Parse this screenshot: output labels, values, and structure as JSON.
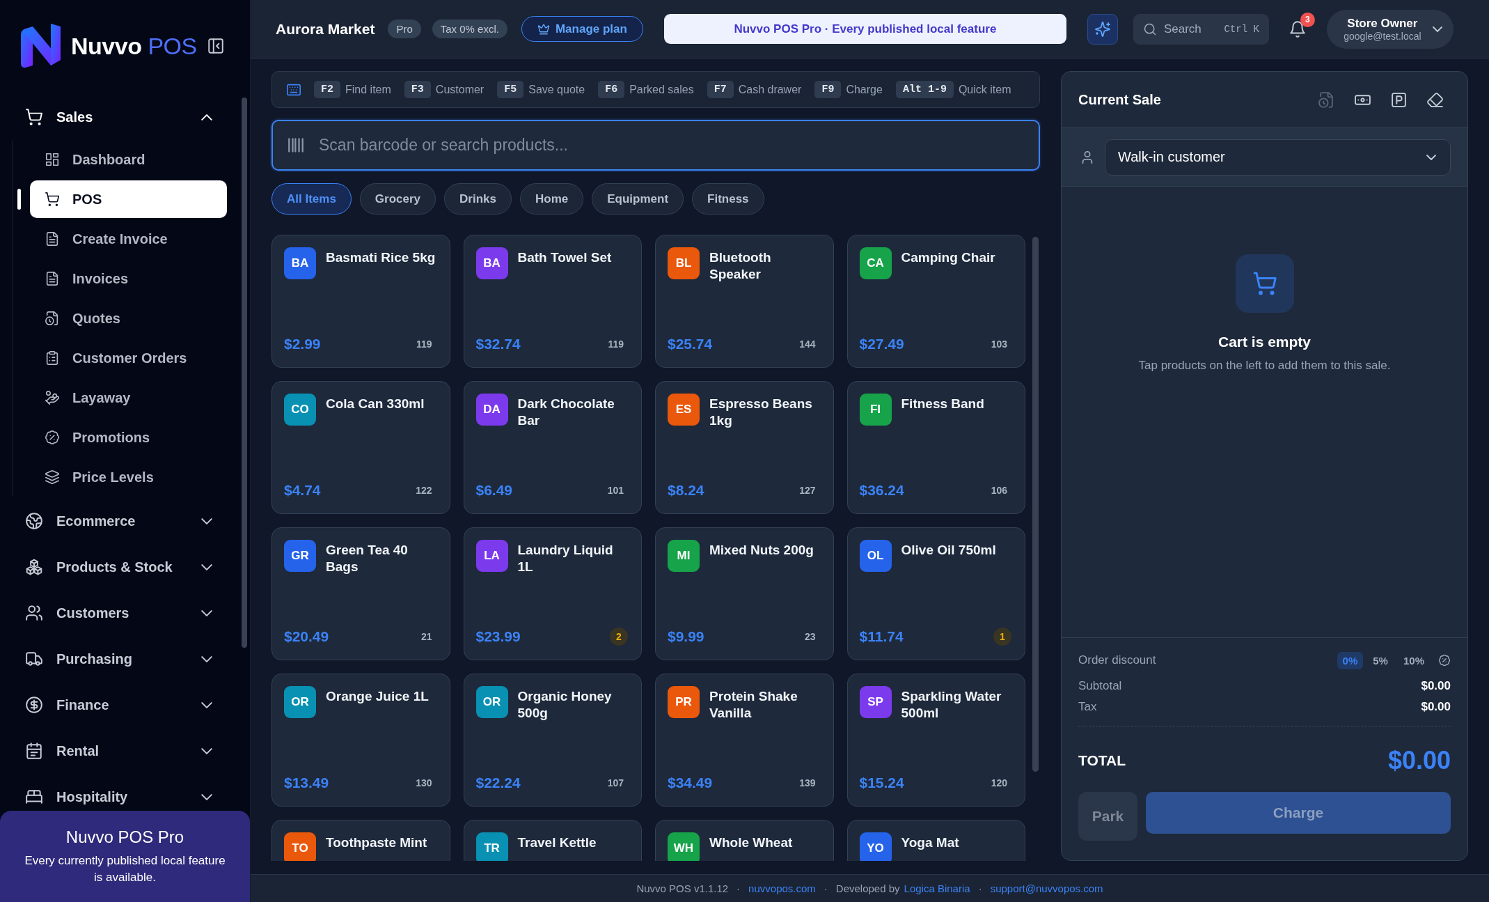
{
  "sidebar": {
    "brand": {
      "name": "Nuvvo",
      "suffix": "POS"
    },
    "nav": [
      {
        "label": "Sales",
        "expanded": true,
        "children": [
          {
            "label": "Dashboard",
            "selected": false
          },
          {
            "label": "POS",
            "selected": true
          },
          {
            "label": "Create Invoice",
            "selected": false
          },
          {
            "label": "Invoices",
            "selected": false
          },
          {
            "label": "Quotes",
            "selected": false
          },
          {
            "label": "Customer Orders",
            "selected": false
          },
          {
            "label": "Layaway",
            "selected": false
          },
          {
            "label": "Promotions",
            "selected": false
          },
          {
            "label": "Price Levels",
            "selected": false
          }
        ]
      },
      {
        "label": "Ecommerce",
        "expanded": false
      },
      {
        "label": "Products & Stock",
        "expanded": false
      },
      {
        "label": "Customers",
        "expanded": false
      },
      {
        "label": "Purchasing",
        "expanded": false
      },
      {
        "label": "Finance",
        "expanded": false
      },
      {
        "label": "Rental",
        "expanded": false
      },
      {
        "label": "Hospitality",
        "expanded": false
      }
    ],
    "promo": {
      "title": "Nuvvo POS Pro",
      "text": "Every currently published local feature is available."
    }
  },
  "topbar": {
    "store": "Aurora Market",
    "plan": "Pro",
    "tax": "Tax 0% excl.",
    "manage_plan": "Manage plan",
    "banner": "Nuvvo POS Pro · Every published local feature",
    "search": {
      "placeholder": "Search",
      "shortcut": "Ctrl K"
    },
    "notifications": "3",
    "user": {
      "name": "Store Owner",
      "email": "google@test.local"
    }
  },
  "shortcuts": [
    {
      "key": "F2",
      "label": "Find item"
    },
    {
      "key": "F3",
      "label": "Customer"
    },
    {
      "key": "F5",
      "label": "Save quote"
    },
    {
      "key": "F6",
      "label": "Parked sales"
    },
    {
      "key": "F7",
      "label": "Cash drawer"
    },
    {
      "key": "F9",
      "label": "Charge"
    },
    {
      "key": "Alt 1-9",
      "label": "Quick item"
    }
  ],
  "product_search": {
    "placeholder": "Scan barcode or search products..."
  },
  "categories": [
    {
      "label": "All Items",
      "selected": true
    },
    {
      "label": "Grocery",
      "selected": false
    },
    {
      "label": "Drinks",
      "selected": false
    },
    {
      "label": "Home",
      "selected": false
    },
    {
      "label": "Equipment",
      "selected": false
    },
    {
      "label": "Fitness",
      "selected": false
    }
  ],
  "products": [
    {
      "initials": "BA",
      "color": "#2563eb",
      "name": "Basmati Rice 5kg",
      "price": "$2.99",
      "stock": "119",
      "low_stock": false
    },
    {
      "initials": "BA",
      "color": "#7c3aed",
      "name": "Bath Towel Set",
      "price": "$32.74",
      "stock": "119",
      "low_stock": false
    },
    {
      "initials": "BL",
      "color": "#ea580c",
      "name": "Bluetooth Speaker",
      "price": "$25.74",
      "stock": "144",
      "low_stock": false
    },
    {
      "initials": "CA",
      "color": "#16a34a",
      "name": "Camping Chair",
      "price": "$27.49",
      "stock": "103",
      "low_stock": false
    },
    {
      "initials": "CO",
      "color": "#0891b2",
      "name": "Cola Can 330ml",
      "price": "$4.74",
      "stock": "122",
      "low_stock": false
    },
    {
      "initials": "DA",
      "color": "#7c3aed",
      "name": "Dark Chocolate Bar",
      "price": "$6.49",
      "stock": "101",
      "low_stock": false
    },
    {
      "initials": "ES",
      "color": "#ea580c",
      "name": "Espresso Beans 1kg",
      "price": "$8.24",
      "stock": "127",
      "low_stock": false
    },
    {
      "initials": "FI",
      "color": "#16a34a",
      "name": "Fitness Band",
      "price": "$36.24",
      "stock": "106",
      "low_stock": false
    },
    {
      "initials": "GR",
      "color": "#2563eb",
      "name": "Green Tea 40 Bags",
      "price": "$20.49",
      "stock": "21",
      "low_stock": false
    },
    {
      "initials": "LA",
      "color": "#7c3aed",
      "name": "Laundry Liquid 1L",
      "price": "$23.99",
      "stock": "2",
      "low_stock": true
    },
    {
      "initials": "MI",
      "color": "#16a34a",
      "name": "Mixed Nuts 200g",
      "price": "$9.99",
      "stock": "23",
      "low_stock": false
    },
    {
      "initials": "OL",
      "color": "#2563eb",
      "name": "Olive Oil 750ml",
      "price": "$11.74",
      "stock": "1",
      "low_stock": true
    },
    {
      "initials": "OR",
      "color": "#0891b2",
      "name": "Orange Juice 1L",
      "price": "$13.49",
      "stock": "130",
      "low_stock": false
    },
    {
      "initials": "OR",
      "color": "#0891b2",
      "name": "Organic Honey 500g",
      "price": "$22.24",
      "stock": "107",
      "low_stock": false
    },
    {
      "initials": "PR",
      "color": "#ea580c",
      "name": "Protein Shake Vanilla",
      "price": "$34.49",
      "stock": "139",
      "low_stock": false
    },
    {
      "initials": "SP",
      "color": "#7c3aed",
      "name": "Sparkling Water 500ml",
      "price": "$15.24",
      "stock": "120",
      "low_stock": false
    },
    {
      "initials": "TO",
      "color": "#ea580c",
      "name": "Toothpaste Mint"
    },
    {
      "initials": "TR",
      "color": "#0891b2",
      "name": "Travel Kettle"
    },
    {
      "initials": "WH",
      "color": "#16a34a",
      "name": "Whole Wheat"
    },
    {
      "initials": "YO",
      "color": "#2563eb",
      "name": "Yoga Mat"
    }
  ],
  "cart": {
    "title": "Current Sale",
    "actions": [
      {
        "kind": "quote",
        "disabled": true
      },
      {
        "kind": "cash",
        "disabled": false
      },
      {
        "kind": "park",
        "disabled": false
      },
      {
        "kind": "clear",
        "disabled": false
      }
    ],
    "customer": {
      "value": "Walk-in customer"
    },
    "empty_title": "Cart is empty",
    "empty_text": "Tap products on the left to add them to this sale.",
    "discount": {
      "label": "Order discount",
      "options": [
        {
          "label": "0%",
          "selected": true
        },
        {
          "label": "5%",
          "selected": false
        },
        {
          "label": "10%",
          "selected": false
        }
      ]
    },
    "subtotal": {
      "label": "Subtotal",
      "value": "$0.00"
    },
    "tax": {
      "label": "Tax",
      "value": "$0.00"
    },
    "total": {
      "label": "TOTAL",
      "value": "$0.00"
    },
    "buttons": [
      {
        "kind": "park",
        "label": "Park",
        "disabled": true
      },
      {
        "kind": "charge",
        "label": "Charge",
        "disabled": true
      }
    ]
  },
  "footer": [
    {
      "kind": "text",
      "text": "Nuvvo POS v1.1.12"
    },
    {
      "kind": "separator",
      "text": "·"
    },
    {
      "kind": "link",
      "text": "nuvvopos.com"
    },
    {
      "kind": "separator",
      "text": "·"
    },
    {
      "kind": "text",
      "text": "Developed by"
    },
    {
      "kind": "link",
      "text": "Logica Binaria"
    },
    {
      "kind": "separator",
      "text": "·"
    },
    {
      "kind": "link",
      "text": "support@nuvvopos.com"
    }
  ]
}
